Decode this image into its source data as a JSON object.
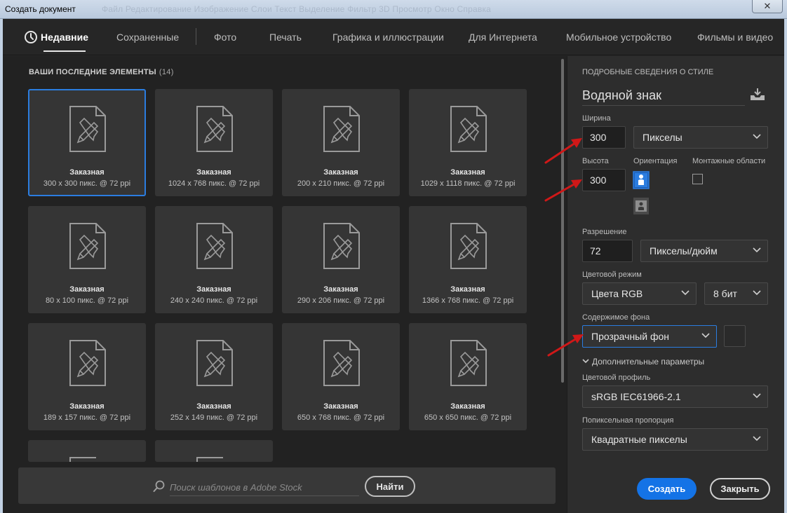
{
  "window": {
    "title": "Создать документ",
    "ghost_menu": "Файл   Редактирование   Изображение   Слои   Текст   Выделение   Фильтр   3D   Просмотр   Окно   Справка",
    "close_glyph": "✕"
  },
  "tabs": [
    {
      "label": "Недавние",
      "active": true
    },
    {
      "label": "Сохраненные"
    },
    {
      "label": "Фото"
    },
    {
      "label": "Печать"
    },
    {
      "label": "Графика и иллюстрации"
    },
    {
      "label": "Для Интернета"
    },
    {
      "label": "Мобильное устройство"
    },
    {
      "label": "Фильмы и видео"
    }
  ],
  "recent": {
    "title": "ВАШИ ПОСЛЕДНИЕ ЭЛЕМЕНТЫ",
    "count": "(14)",
    "items": [
      {
        "name": "Заказная",
        "size": "300 x 300 пикс. @ 72 ppi",
        "selected": true
      },
      {
        "name": "Заказная",
        "size": "1024 x 768 пикс. @ 72 ppi"
      },
      {
        "name": "Заказная",
        "size": "200 x 210 пикс. @ 72 ppi"
      },
      {
        "name": "Заказная",
        "size": "1029 x 1118 пикс. @ 72 ppi"
      },
      {
        "name": "Заказная",
        "size": "80 x 100 пикс. @ 72 ppi"
      },
      {
        "name": "Заказная",
        "size": "240 x 240 пикс. @ 72 ppi"
      },
      {
        "name": "Заказная",
        "size": "290 x 206 пикс. @ 72 ppi"
      },
      {
        "name": "Заказная",
        "size": "1366 x 768 пикс. @ 72 ppi"
      },
      {
        "name": "Заказная",
        "size": "189 x 157 пикс. @ 72 ppi"
      },
      {
        "name": "Заказная",
        "size": "252 x 149 пикс. @ 72 ppi"
      },
      {
        "name": "Заказная",
        "size": "650 x 768 пикс. @ 72 ppi"
      },
      {
        "name": "Заказная",
        "size": "650 x 650 пикс. @ 72 ppi"
      }
    ]
  },
  "search": {
    "placeholder": "Поиск шаблонов в Adobe Stock",
    "button": "Найти"
  },
  "details": {
    "heading": "ПОДРОБНЫЕ СВЕДЕНИЯ О СТИЛЕ",
    "preset_name": "Водяной знак",
    "width_label": "Ширина",
    "width_value": "300",
    "width_unit": "Пикселы",
    "height_label": "Высота",
    "height_value": "300",
    "orientation_label": "Ориентация",
    "artboards_label": "Монтажные области",
    "resolution_label": "Разрешение",
    "resolution_value": "72",
    "resolution_unit": "Пикселы/дюйм",
    "color_mode_label": "Цветовой режим",
    "color_mode_value": "Цвета RGB",
    "bit_depth_value": "8 бит",
    "background_label": "Содержимое фона",
    "background_value": "Прозрачный фон",
    "advanced_label": "Дополнительные параметры",
    "profile_label": "Цветовой профиль",
    "profile_value": "sRGB IEC61966-2.1",
    "pixel_aspect_label": "Попиксельная пропорция",
    "pixel_aspect_value": "Квадратные пикселы"
  },
  "actions": {
    "create": "Создать",
    "close": "Закрыть"
  },
  "colors": {
    "accent": "#1473e6",
    "selection": "#2b7de0",
    "annotation_arrow": "#d01818"
  },
  "icons": [
    "clock-icon",
    "document-icon",
    "search-icon",
    "save-preset-icon",
    "chevron-down-icon",
    "portrait-icon",
    "landscape-icon"
  ]
}
